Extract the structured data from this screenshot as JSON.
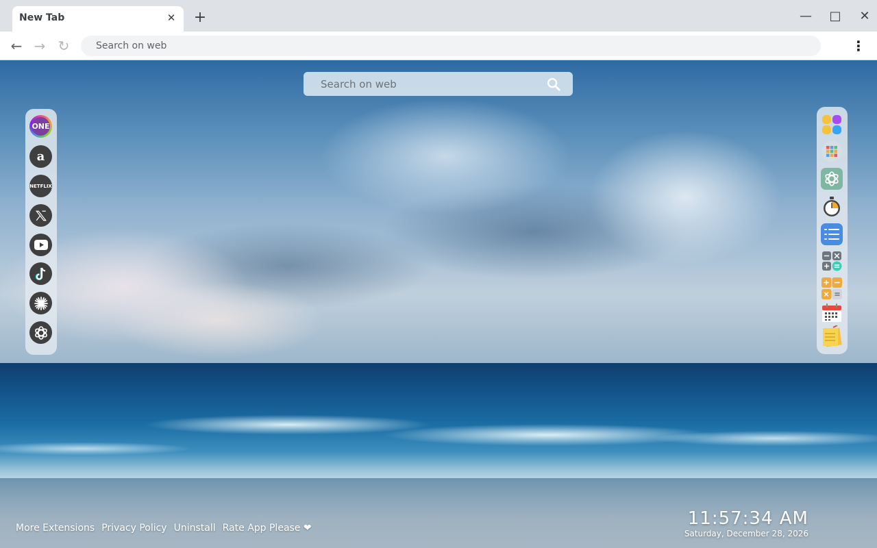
{
  "browser": {
    "tab_title": "New Tab",
    "tab_close": "✕",
    "new_tab": "+",
    "omnibox_placeholder": "Search on web",
    "back": "←",
    "forward": "→",
    "reload": "↻",
    "menu": "⋮",
    "minimize": "—",
    "maximize": "□",
    "close": "✕"
  },
  "page": {
    "search_placeholder": "Search on web",
    "left_dock": [
      {
        "name": "one",
        "label": "ONE",
        "icon": "one-logo-icon"
      },
      {
        "name": "amazon",
        "label": "a",
        "icon": "amazon-icon"
      },
      {
        "name": "netflix",
        "label": "NETFLIX",
        "icon": "netflix-icon"
      },
      {
        "name": "x",
        "label": "𝕏",
        "icon": "x-icon"
      },
      {
        "name": "youtube",
        "label": "▶",
        "icon": "youtube-icon"
      },
      {
        "name": "tiktok",
        "label": "♪",
        "icon": "tiktok-icon"
      },
      {
        "name": "perplexity",
        "label": "✳",
        "icon": "perplexity-icon"
      },
      {
        "name": "chatgpt",
        "label": "⎔",
        "icon": "chatgpt-icon"
      }
    ],
    "right_dock": [
      {
        "name": "apps-grid",
        "icon": "apps-grid-icon"
      },
      {
        "name": "apps-menu",
        "icon": "apps-menu-icon"
      },
      {
        "name": "chatgpt",
        "icon": "chatgpt-icon"
      },
      {
        "name": "timer",
        "icon": "stopwatch-icon"
      },
      {
        "name": "todo",
        "icon": "checklist-icon"
      },
      {
        "name": "calculator",
        "icon": "calculator-icon"
      },
      {
        "name": "calculator-2",
        "icon": "calculator-orange-icon"
      },
      {
        "name": "calendar",
        "icon": "calendar-icon"
      },
      {
        "name": "notes",
        "icon": "sticky-note-icon"
      }
    ],
    "footer_links": [
      "More Extensions",
      "Privacy Policy",
      "Uninstall",
      "Rate App Please ❤"
    ],
    "clock": {
      "time": "11:57:34 AM",
      "date": "Saturday, December 28, 2026"
    }
  }
}
